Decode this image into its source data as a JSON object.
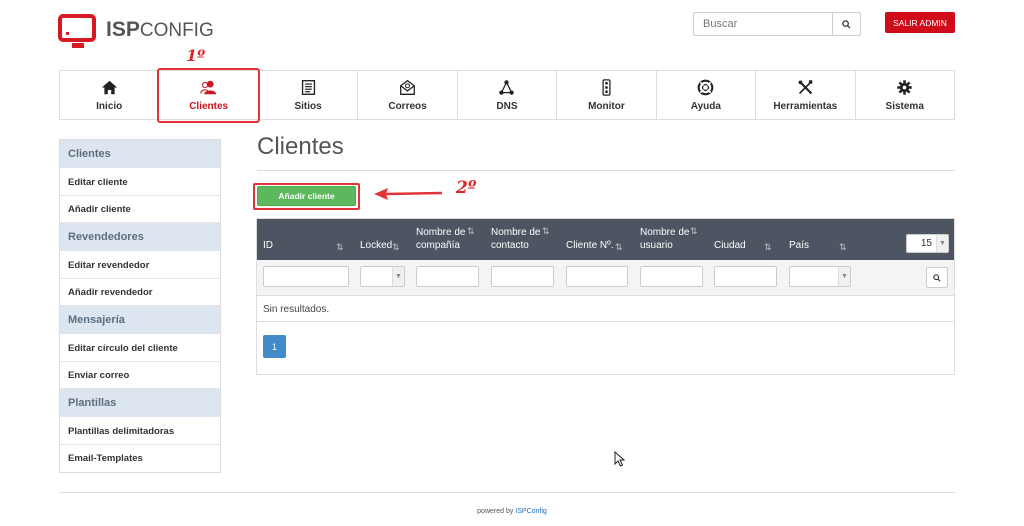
{
  "header": {
    "logo_bold": "ISP",
    "logo_rest": "CONFIG",
    "search_placeholder": "Buscar",
    "logout_label": "SALIR ADMIN"
  },
  "annotations": {
    "step1": "1º",
    "step2": "2º"
  },
  "nav": [
    {
      "label": "Inicio",
      "icon": "home-icon"
    },
    {
      "label": "Clientes",
      "icon": "users-icon",
      "active": true
    },
    {
      "label": "Sitios",
      "icon": "sites-icon"
    },
    {
      "label": "Correos",
      "icon": "mail-icon"
    },
    {
      "label": "DNS",
      "icon": "network-icon"
    },
    {
      "label": "Monitor",
      "icon": "traffic-light-icon"
    },
    {
      "label": "Ayuda",
      "icon": "lifebuoy-icon"
    },
    {
      "label": "Herramientas",
      "icon": "tools-icon"
    },
    {
      "label": "Sistema",
      "icon": "gear-icon"
    }
  ],
  "sidebar": {
    "sections": [
      {
        "title": "Clientes",
        "items": [
          "Editar cliente",
          "Añadir cliente"
        ]
      },
      {
        "title": "Revendedores",
        "items": [
          "Editar revendedor",
          "Añadir revendedor"
        ]
      },
      {
        "title": "Mensajería",
        "items": [
          "Editar círculo del cliente",
          "Enviar correo"
        ]
      },
      {
        "title": "Plantillas",
        "items": [
          "Plantillas delimitadoras",
          "Email-Templates"
        ]
      }
    ]
  },
  "main": {
    "title": "Clientes",
    "add_button": "Añadir cliente",
    "columns": [
      "ID",
      "Locked",
      "Nombre de compañía",
      "Nombre de contacto",
      "Cliente Nº.",
      "Nombre de usuario",
      "Ciudad",
      "País"
    ],
    "col_line1": [
      "",
      "",
      "Nombre de",
      "Nombre de",
      "",
      "Nombre de",
      "",
      ""
    ],
    "col_line2": [
      "ID",
      "Locked",
      "compañía",
      "contacto",
      "Cliente Nº.",
      "usuario",
      "Ciudad",
      "País"
    ],
    "sort_glyph": "⇅",
    "per_page": "15",
    "empty_text": "Sin resultados.",
    "current_page": "1"
  },
  "footer": {
    "prefix": "powered by",
    "link": "ISPConfig"
  },
  "colors": {
    "brand_red": "#d00c1b",
    "header_dark": "#4c5561",
    "add_green": "#5cb85c",
    "page_blue": "#428bca",
    "sidebar_head": "#dde6f0"
  }
}
